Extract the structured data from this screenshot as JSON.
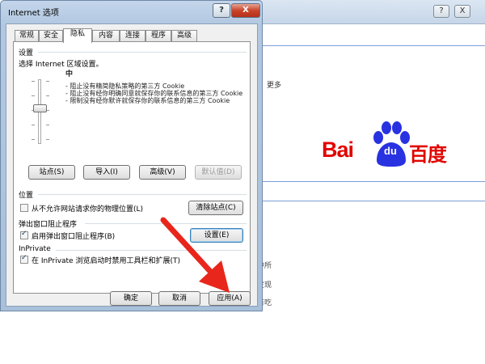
{
  "background_page": {
    "more_text": "更多",
    "fragments": [
      "中所",
      "发现",
      "有吃"
    ],
    "window_buttons": [
      "?",
      "X"
    ]
  },
  "baidu_logo": {
    "left": "Bai",
    "paw_text": "du",
    "right": "百度",
    "brand_color": "#e10601",
    "paw_color": "#2932e1"
  },
  "dialog": {
    "title": "Internet 选项",
    "help_label": "?",
    "close_label": "X",
    "tabs": [
      "常规",
      "安全",
      "隐私",
      "内容",
      "连接",
      "程序",
      "高级"
    ],
    "active_tab": "隐私",
    "settings": {
      "group_label": "设置",
      "instruction": "选择 Internet 区域设置。",
      "level_name": "中",
      "level_lines": [
        "- 阻止没有精简隐私策略的第三方 Cookie",
        "- 阻止没有经你明确同意就保存你的联系信息的第三方 Cookie",
        "- 限制没有经你默许就保存你的联系信息的第三方 Cookie"
      ],
      "buttons": {
        "sites": "站点(S)",
        "import": "导入(I)",
        "advanced": "高级(V)",
        "default": "默认值(D)"
      }
    },
    "location": {
      "group_label": "位置",
      "checkbox_label": "从不允许网站请求你的物理位置(L)",
      "checked": false,
      "clear_button": "清除站点(C)"
    },
    "popup_blocker": {
      "group_label": "弹出窗口阻止程序",
      "checkbox_label": "启用弹出窗口阻止程序(B)",
      "checked": true,
      "settings_button": "设置(E)"
    },
    "inprivate": {
      "group_label": "InPrivate",
      "checkbox_label": "在 InPrivate 浏览启动时禁用工具栏和扩展(T)",
      "checked": true
    },
    "footer_buttons": {
      "ok": "确定",
      "cancel": "取消",
      "apply": "应用(A)"
    }
  },
  "annotation": {
    "arrow_color": "#e8261b"
  }
}
